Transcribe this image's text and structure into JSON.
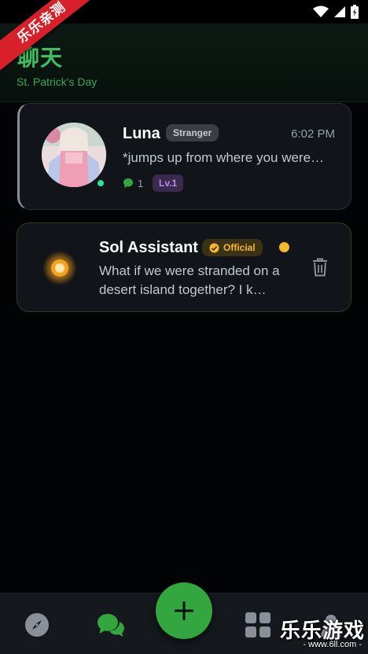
{
  "header": {
    "title": "聊天",
    "subtitle": "St. Patrick's Day"
  },
  "ribbon": {
    "text": "乐乐亲测"
  },
  "chats": [
    {
      "name": "Luna",
      "badge": "Stranger",
      "time": "6:02 PM",
      "preview": "*jumps up from where you were…",
      "message_count": "1",
      "level": "Lv.1",
      "online": true
    },
    {
      "name": "Sol Assistant",
      "badge": "Official",
      "preview": "What if we were stranded on a desert island together? I k…",
      "unread": true
    }
  ],
  "nav": {
    "items": [
      "discover",
      "chats",
      "create",
      "apps",
      "profile"
    ],
    "active": "chats"
  },
  "watermark": {
    "main": "乐乐游戏",
    "sub": "- www.6ll.com -"
  },
  "colors": {
    "accent": "#33a63f",
    "online": "#2de39a",
    "official": "#f5b82e",
    "level": "#b98ae8"
  }
}
